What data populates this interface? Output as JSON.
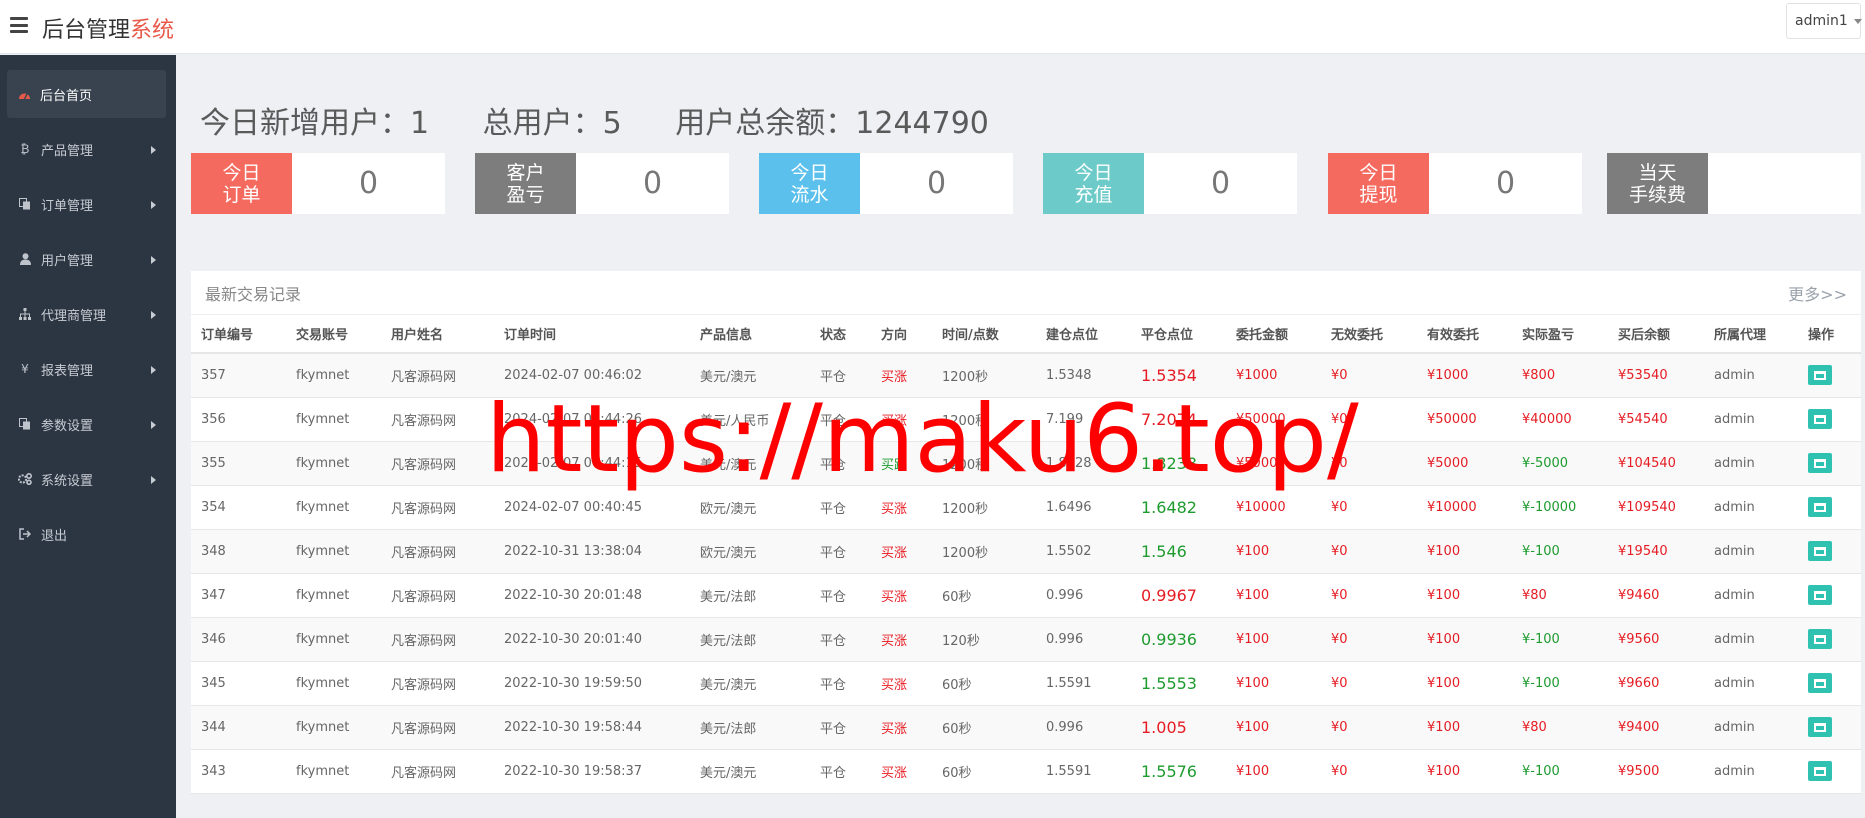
{
  "header": {
    "brand_main": "后台管理",
    "brand_accent": "系统",
    "user": "admin1"
  },
  "sidebar": {
    "items": [
      {
        "label": "后台首页",
        "icon": "dashboard-icon",
        "active": true
      },
      {
        "label": "产品管理",
        "icon": "bitcoin-icon"
      },
      {
        "label": "订单管理",
        "icon": "copy-icon"
      },
      {
        "label": "用户管理",
        "icon": "user-icon"
      },
      {
        "label": "代理商管理",
        "icon": "sitemap-icon"
      },
      {
        "label": "报表管理",
        "icon": "yen-icon"
      },
      {
        "label": "参数设置",
        "icon": "copy-icon"
      },
      {
        "label": "系统设置",
        "icon": "gears-icon"
      },
      {
        "label": "退出",
        "icon": "sign-out-icon"
      }
    ]
  },
  "stats": {
    "new_users": "今日新增用户：1",
    "total_users": "总用户：5",
    "total_balance": "用户总余额：1244790"
  },
  "cards": [
    {
      "label": "今日\n订单",
      "value": "0",
      "color": "#f56a5e"
    },
    {
      "label": "客户\n盈亏",
      "value": "0",
      "color": "#7d7d7d"
    },
    {
      "label": "今日\n流水",
      "value": "0",
      "color": "#5bc0eb"
    },
    {
      "label": "今日\n充值",
      "value": "0",
      "color": "#6ccac9"
    },
    {
      "label": "今日\n提现",
      "value": "0",
      "color": "#f56a5e"
    },
    {
      "label": "当天\n手续费",
      "value": "",
      "color": "#7d7d7d"
    }
  ],
  "panel": {
    "title": "最新交易记录",
    "more": "更多>>"
  },
  "table": {
    "headers": [
      "订单编号",
      "交易账号",
      "用户姓名",
      "订单时间",
      "产品信息",
      "状态",
      "方向",
      "时间/点数",
      "建仓点位",
      "平仓点位",
      "委托金额",
      "无效委托",
      "有效委托",
      "实际盈亏",
      "买后余额",
      "所属代理",
      "操作"
    ],
    "rows": [
      [
        "357",
        "fkymnet",
        "凡客源码网",
        "2024-02-07 00:46:02",
        "美元/澳元",
        "平仓",
        "买涨",
        "1200秒",
        "1.5348",
        "1.5354",
        "¥1000",
        "¥0",
        "¥1000",
        "¥800",
        "¥53540",
        "admin"
      ],
      [
        "356",
        "fkymnet",
        "凡客源码网",
        "2024-02-07 00:44:26",
        "美元/人民币",
        "平仓",
        "买涨",
        "1200秒",
        "7.199",
        "7.2074",
        "¥50000",
        "¥0",
        "¥50000",
        "¥40000",
        "¥54540",
        "admin"
      ],
      [
        "355",
        "fkymnet",
        "凡客源码网",
        "2024-02-07 00:44:15",
        "美元/澳元",
        "平仓",
        "买跌",
        "1200秒",
        "1.8228",
        "1.8238",
        "¥5000",
        "¥0",
        "¥5000",
        "¥-5000",
        "¥104540",
        "admin"
      ],
      [
        "354",
        "fkymnet",
        "凡客源码网",
        "2024-02-07 00:40:45",
        "欧元/澳元",
        "平仓",
        "买涨",
        "1200秒",
        "1.6496",
        "1.6482",
        "¥10000",
        "¥0",
        "¥10000",
        "¥-10000",
        "¥109540",
        "admin"
      ],
      [
        "348",
        "fkymnet",
        "凡客源码网",
        "2022-10-31 13:38:04",
        "欧元/澳元",
        "平仓",
        "买涨",
        "1200秒",
        "1.5502",
        "1.546",
        "¥100",
        "¥0",
        "¥100",
        "¥-100",
        "¥19540",
        "admin"
      ],
      [
        "347",
        "fkymnet",
        "凡客源码网",
        "2022-10-30 20:01:48",
        "美元/法郎",
        "平仓",
        "买涨",
        "60秒",
        "0.996",
        "0.9967",
        "¥100",
        "¥0",
        "¥100",
        "¥80",
        "¥9460",
        "admin"
      ],
      [
        "346",
        "fkymnet",
        "凡客源码网",
        "2022-10-30 20:01:40",
        "美元/法郎",
        "平仓",
        "买涨",
        "120秒",
        "0.996",
        "0.9936",
        "¥100",
        "¥0",
        "¥100",
        "¥-100",
        "¥9560",
        "admin"
      ],
      [
        "345",
        "fkymnet",
        "凡客源码网",
        "2022-10-30 19:59:50",
        "美元/澳元",
        "平仓",
        "买涨",
        "60秒",
        "1.5591",
        "1.5553",
        "¥100",
        "¥0",
        "¥100",
        "¥-100",
        "¥9660",
        "admin"
      ],
      [
        "344",
        "fkymnet",
        "凡客源码网",
        "2022-10-30 19:58:44",
        "美元/法郎",
        "平仓",
        "买涨",
        "60秒",
        "0.996",
        "1.005",
        "¥100",
        "¥0",
        "¥100",
        "¥80",
        "¥9400",
        "admin"
      ],
      [
        "343",
        "fkymnet",
        "凡客源码网",
        "2022-10-30 19:58:37",
        "美元/澳元",
        "平仓",
        "买涨",
        "60秒",
        "1.5591",
        "1.5576",
        "¥100",
        "¥0",
        "¥100",
        "¥-100",
        "¥9500",
        "admin"
      ]
    ]
  },
  "watermark": "https://maku6.top/"
}
